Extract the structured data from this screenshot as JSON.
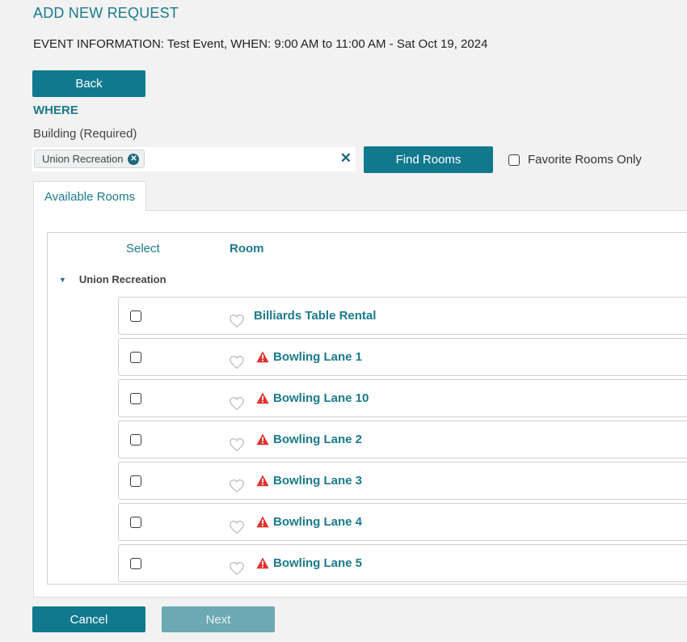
{
  "page": {
    "title": "ADD NEW REQUEST",
    "event_info": "EVENT INFORMATION: Test Event, WHEN: 9:00 AM to 11:00 AM - Sat Oct 19, 2024"
  },
  "buttons": {
    "back": "Back",
    "find_rooms": "Find Rooms",
    "cancel": "Cancel",
    "next": "Next"
  },
  "where": {
    "heading": "WHERE",
    "building_label": "Building (Required)",
    "selected_building": "Union Recreation",
    "favorite_only_label": "Favorite Rooms Only",
    "favorite_only_checked": false
  },
  "tabs": [
    {
      "label": "Available Rooms",
      "active": true
    }
  ],
  "table": {
    "columns": {
      "select": "Select",
      "room": "Room"
    },
    "group": "Union Recreation",
    "rows": [
      {
        "name": "Billiards Table Rental",
        "warning": false,
        "selected": false
      },
      {
        "name": "Bowling Lane 1",
        "warning": true,
        "selected": false
      },
      {
        "name": "Bowling Lane 10",
        "warning": true,
        "selected": false
      },
      {
        "name": "Bowling Lane 2",
        "warning": true,
        "selected": false
      },
      {
        "name": "Bowling Lane 3",
        "warning": true,
        "selected": false
      },
      {
        "name": "Bowling Lane 4",
        "warning": true,
        "selected": false
      },
      {
        "name": "Bowling Lane 5",
        "warning": true,
        "selected": false
      }
    ]
  },
  "colors": {
    "accent": "#10798e",
    "link": "#1b7a8c",
    "warning": "#e0322f",
    "disabled": "#6ba9b5"
  },
  "icons": {
    "chip_remove": "close-circle-icon",
    "clear": "close-icon",
    "caret": "caret-down-icon",
    "favorite": "heart-outline-icon",
    "warning": "warning-triangle-icon"
  }
}
